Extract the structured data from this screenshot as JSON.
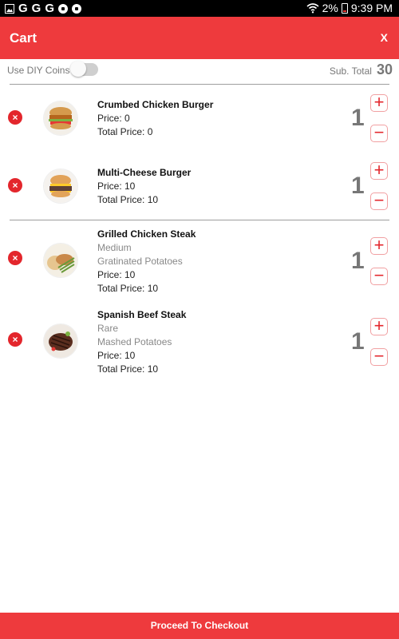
{
  "status_bar": {
    "battery": "2%",
    "time": "9:39 PM",
    "g_icons": [
      "G",
      "G",
      "G"
    ]
  },
  "header": {
    "title": "Cart",
    "close_label": "X"
  },
  "coins": {
    "label": "Use DIY Coins",
    "enabled": false,
    "subtotal_label": "Sub. Total",
    "subtotal_value": "30"
  },
  "items": [
    {
      "name": "Crumbed Chicken Burger",
      "options": [],
      "price": "Price: 0",
      "total": "Total Price: 0",
      "quantity": "1",
      "image": "chicken-burger"
    },
    {
      "name": "Multi-Cheese Burger",
      "options": [],
      "price": "Price: 10",
      "total": "Total Price: 10",
      "quantity": "1",
      "image": "cheese-burger"
    },
    {
      "name": "Grilled Chicken Steak",
      "options": [
        "Medium",
        "Gratinated Potatoes"
      ],
      "price": "Price: 10",
      "total": "Total Price: 10",
      "quantity": "1",
      "image": "chicken-steak"
    },
    {
      "name": "Spanish Beef Steak",
      "options": [
        "Rare",
        "Mashed Potatoes"
      ],
      "price": "Price: 10",
      "total": "Total Price: 10",
      "quantity": "1",
      "image": "beef-steak"
    }
  ],
  "buttons": {
    "remove": "×",
    "plus": "+",
    "minus": "−"
  },
  "checkout_label": "Proceed To Checkout",
  "colors": {
    "accent": "#ee3a3d",
    "remove": "#e3262c",
    "muted": "#777777"
  }
}
